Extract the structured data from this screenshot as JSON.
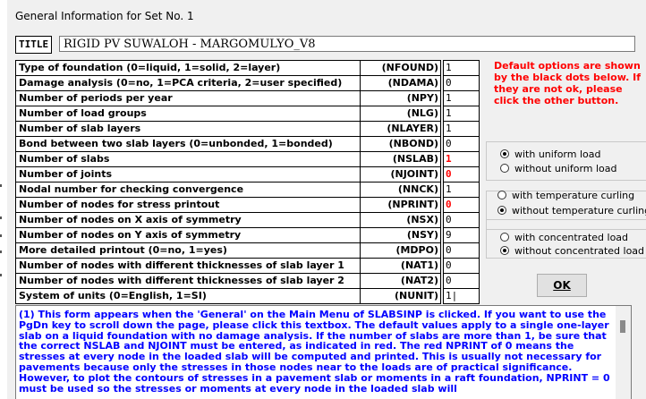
{
  "window": {
    "caption": "General Information for Set No.  1"
  },
  "title_field": {
    "label": "TITLE",
    "value": "RIGID PV SUWALOH - MARGOMULYO_V8"
  },
  "params": [
    {
      "desc": "Type of foundation (0=liquid, 1=solid, 2=layer)",
      "code": "(NFOUND)",
      "value": "1",
      "red": false
    },
    {
      "desc": "Damage analysis (0=no, 1=PCA criteria, 2=user specified)",
      "code": "(NDAMA)",
      "value": "0",
      "red": false
    },
    {
      "desc": "Number of periods per year",
      "code": "(NPY)",
      "value": "1",
      "red": false
    },
    {
      "desc": "Number of load groups",
      "code": "(NLG)",
      "value": "1",
      "red": false
    },
    {
      "desc": "Number of slab layers",
      "code": "(NLAYER)",
      "value": "1",
      "red": false
    },
    {
      "desc": "Bond between two slab layers (0=unbonded, 1=bonded)",
      "code": "(NBOND)",
      "value": "0",
      "red": false
    },
    {
      "desc": "Number of slabs",
      "code": "(NSLAB)",
      "value": "1",
      "red": true
    },
    {
      "desc": "Number of joints",
      "code": "(NJOINT)",
      "value": "0",
      "red": true
    },
    {
      "desc": "Nodal number for checking convergence",
      "code": "(NNCK)",
      "value": "1",
      "red": false
    },
    {
      "desc": "Number of nodes for stress printout",
      "code": "(NPRINT)",
      "value": "0",
      "red": true
    },
    {
      "desc": "Number of nodes on X axis of symmetry",
      "code": "(NSX)",
      "value": "0",
      "red": false
    },
    {
      "desc": "Number of nodes on Y axis of symmetry",
      "code": "(NSY)",
      "value": "9",
      "red": false
    },
    {
      "desc": "More detailed printout (0=no, 1=yes)",
      "code": "(MDPO)",
      "value": "0",
      "red": false
    },
    {
      "desc": "Number of nodes with different thicknesses of slab layer 1",
      "code": "(NAT1)",
      "value": "0",
      "red": false
    },
    {
      "desc": "Number of nodes with different thicknesses of slab layer 2",
      "code": "(NAT2)",
      "value": "0",
      "red": false
    },
    {
      "desc": "System of units (0=English, 1=SI)",
      "code": "(NUNIT)",
      "value": "1|",
      "red": false
    }
  ],
  "note": {
    "text": "Default options are shown by the black dots below. If they are not ok, please click the other button."
  },
  "uniform": {
    "options": [
      "with uniform load",
      "without uniform load"
    ],
    "selected": 0
  },
  "temperature": {
    "options": [
      "with temperature curling",
      "without temperature curling"
    ],
    "selected": 1
  },
  "concentrated": {
    "options": [
      "with concentrated load",
      "without concentrated load"
    ],
    "selected": 1
  },
  "ok_button": {
    "label": "OK"
  },
  "help": {
    "text": "(1) This form appears when the 'General' on the Main Menu of SLABSINP is clicked.  If you want to use the PgDn key to scroll down the page, please click this textbox.  The default values apply to a single one-layer slab on a liquid foundation with no damage analysis.  If the number of slabs are more than 1, be sure that the correct NSLAB and NJOINT must be entered, as indicated in red.  The red NPRINT of 0 means the stresses at every node in the loaded slab will be computed and printed.  This is usually not necessary for pavements because only the stresses in those nodes near to the loads are of practical significance.  However, to plot the contours of stresses in a pavement slab or moments in a raft foundation, NPRINT = 0 must be used so the stresses or moments at every node in the loaded slab will"
  },
  "colors": {
    "note_red": "#ff0000",
    "help_blue": "#0000ff",
    "dialog_bg": "#f0f0f0"
  }
}
